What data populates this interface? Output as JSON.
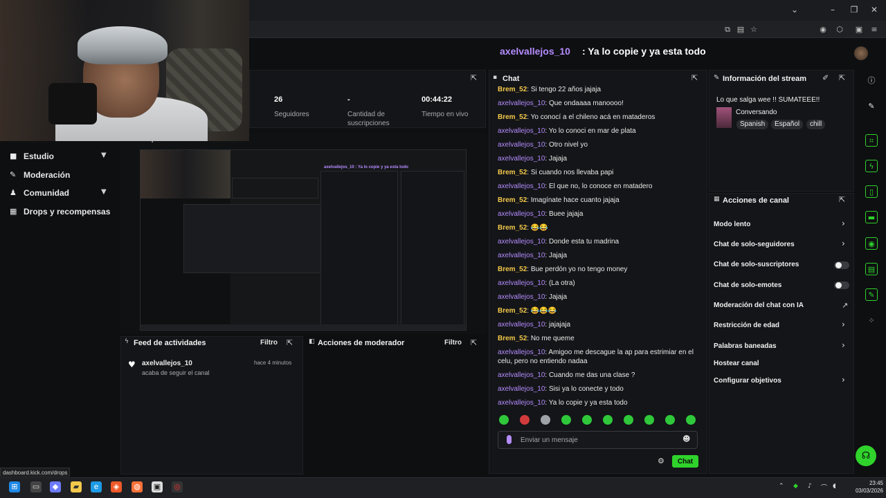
{
  "top_chat": {
    "user": "axelvallejos_10",
    "message": ": Ya lo copie y ya esta todo"
  },
  "nav": {
    "items": [
      {
        "label": "Estudio",
        "icon": "video-icon",
        "expandable": true
      },
      {
        "label": "Moderación",
        "icon": "wrench-icon",
        "expandable": false
      },
      {
        "label": "Comunidad",
        "icon": "users-icon",
        "expandable": true
      },
      {
        "label": "Drops y recompensas",
        "icon": "gift-icon",
        "expandable": false
      }
    ],
    "status_url": "dashboard.kick.com/drops"
  },
  "stats": {
    "followers_value": "26",
    "followers_label": "Seguidores",
    "subs_value": "-",
    "subs_label": "Cantidad de suscripciones",
    "live_value": "00:44:22",
    "live_label": "Tiempo en vivo"
  },
  "preview": {
    "label": "Vista previa del stream",
    "inner_title": "axelvallejos_10 : Ya lo copie y ya esta todo"
  },
  "feed": {
    "title": "Feed de actividades",
    "filter": "Filtro",
    "items": [
      {
        "user": "axelvallejos_10",
        "time": "hace 4 minutos",
        "action": "acaba de seguir el canal"
      }
    ]
  },
  "modactions": {
    "title": "Acciones de moderador",
    "filter": "Filtro"
  },
  "chat": {
    "title": "Chat",
    "messages": [
      {
        "user": "Brem_52",
        "text": ": Si tengo 22 años jajaja",
        "color": "yellow"
      },
      {
        "user": "axelvallejos_10",
        "text": ": Que ondaaaa manoooo!",
        "color": "purple"
      },
      {
        "user": "Brem_52",
        "text": ": Yo conocí a el chileno acá en mataderos",
        "color": "yellow"
      },
      {
        "user": "axelvallejos_10",
        "text": ": Yo lo conoci en mar de plata",
        "color": "purple"
      },
      {
        "user": "axelvallejos_10",
        "text": ": Otro nivel yo",
        "color": "purple"
      },
      {
        "user": "axelvallejos_10",
        "text": ": Jajaja",
        "color": "purple"
      },
      {
        "user": "Brem_52",
        "text": ": Si cuando nos llevaba papi",
        "color": "yellow"
      },
      {
        "user": "axelvallejos_10",
        "text": ": El que no, lo conoce en matadero",
        "color": "purple"
      },
      {
        "user": "Brem_52",
        "text": ": Imagínate hace cuanto jajaja",
        "color": "yellow"
      },
      {
        "user": "axelvallejos_10",
        "text": ": Buee jajaja",
        "color": "purple"
      },
      {
        "user": "Brem_52",
        "text": ": 😂😂",
        "color": "yellow"
      },
      {
        "user": "axelvallejos_10",
        "text": ": Donde esta tu madrina",
        "color": "purple"
      },
      {
        "user": "axelvallejos_10",
        "text": ": Jajaja",
        "color": "purple"
      },
      {
        "user": "Brem_52",
        "text": ": Bue perdón yo no tengo money",
        "color": "yellow"
      },
      {
        "user": "axelvallejos_10",
        "text": ": (La otra)",
        "color": "purple"
      },
      {
        "user": "axelvallejos_10",
        "text": ": Jajaja",
        "color": "purple"
      },
      {
        "user": "Brem_52",
        "text": ": 😂😂😂",
        "color": "yellow"
      },
      {
        "user": "axelvallejos_10",
        "text": ": jajajaja",
        "color": "purple"
      },
      {
        "user": "Brem_52",
        "text": ": No me queme",
        "color": "yellow"
      },
      {
        "user": "axelvallejos_10",
        "text": ": Amigoo me descague la ap para estrimiar en el celu, pero no entiendo nadaa",
        "color": "purple"
      },
      {
        "user": "axelvallejos_10",
        "text": ": Cuando me das una clase ?",
        "color": "purple"
      },
      {
        "user": "axelvallejos_10",
        "text": ": Sisi ya lo conecte y todo",
        "color": "purple"
      },
      {
        "user": "axelvallejos_10",
        "text": ": Ya lo copie y ya esta todo",
        "color": "purple"
      }
    ],
    "input_placeholder": "Enviar un mensaje",
    "send_label": "Chat"
  },
  "stream_info": {
    "title": "Información del stream",
    "stream_title": "Lo que salga wee !! SUMATEEE!!",
    "category": "Conversando",
    "tags": [
      "Spanish",
      "Español",
      "chill"
    ]
  },
  "channel_actions": {
    "title": "Acciones de canal",
    "items": [
      {
        "label": "Modo lento",
        "control": "chevron"
      },
      {
        "label": "Chat de solo-seguidores",
        "control": "chevron"
      },
      {
        "label": "Chat de solo-suscriptores",
        "control": "toggle"
      },
      {
        "label": "Chat de solo-emotes",
        "control": "toggle"
      },
      {
        "label": "Moderación del chat con IA",
        "control": "external"
      },
      {
        "label": "Restricción de edad",
        "control": "chevron"
      },
      {
        "label": "Palabras baneadas",
        "control": "chevron"
      },
      {
        "label": "Hostear canal",
        "control": "none"
      },
      {
        "label": "Configurar objetivos",
        "control": "chevron"
      }
    ]
  },
  "taskbar": {
    "time": "23:45",
    "date": "03/03/2026"
  },
  "colors": {
    "accent": "#2fd32b",
    "username_purple": "#b48cff",
    "username_yellow": "#f3c94b"
  }
}
